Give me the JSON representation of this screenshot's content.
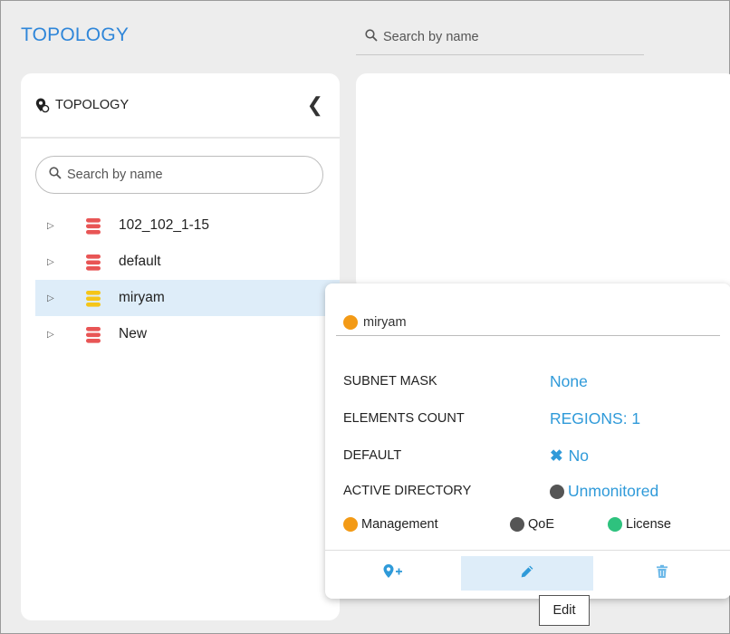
{
  "app": {
    "title": "TOPOLOGY"
  },
  "top_search": {
    "placeholder": "Search by name"
  },
  "panel": {
    "title": "TOPOLOGY",
    "search_placeholder": "Search by name",
    "tree": [
      {
        "name": "102_102_1-15",
        "color": "#e85555"
      },
      {
        "name": "default",
        "color": "#e85555"
      },
      {
        "name": "miryam",
        "color": "#f5c518",
        "selected": true
      },
      {
        "name": "New",
        "color": "#e85555"
      }
    ]
  },
  "popup": {
    "title": "miryam",
    "title_dot_color": "#f39a16",
    "properties": [
      {
        "key": "SUBNET MASK",
        "value": "None"
      },
      {
        "key": "ELEMENTS COUNT",
        "value": "REGIONS: 1"
      },
      {
        "key": "DEFAULT",
        "value": "No",
        "icon": "x-icon"
      },
      {
        "key": "ACTIVE DIRECTORY",
        "value": "Unmonitored",
        "icon": "status-dot-icon"
      }
    ],
    "legend": [
      {
        "label": "Management",
        "color": "#f39a16"
      },
      {
        "label": "QoE",
        "color": "#555555"
      },
      {
        "label": "License",
        "color": "#2ec27e"
      }
    ],
    "actions": [
      {
        "name": "add-location",
        "icon": "pin-plus-icon"
      },
      {
        "name": "edit",
        "icon": "pencil-icon"
      },
      {
        "name": "delete",
        "icon": "trash-icon"
      }
    ]
  },
  "tooltip": {
    "text": "Edit"
  },
  "colors": {
    "accent": "#2f86d9",
    "link": "#2f9ad9",
    "selected_bg": "#deedf9"
  }
}
